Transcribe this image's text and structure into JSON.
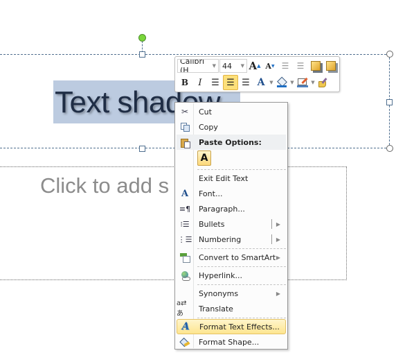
{
  "slide": {
    "title_text": "Text shadow",
    "subtitle_placeholder": "Click to add s"
  },
  "mini_toolbar": {
    "font_name": "Calibri (H",
    "font_size": "44",
    "buttons_row1": [
      "grow-font",
      "shrink-font",
      "decrease-indent",
      "increase-indent",
      "bring-to-front",
      "send-to-back"
    ],
    "buttons_row2": [
      "bold",
      "italic",
      "align-left",
      "align-center",
      "align-right",
      "font-color",
      "shape-fill",
      "shape-outline",
      "format-painter"
    ],
    "bold_glyph": "B",
    "italic_glyph": "I",
    "font_color_glyph": "A",
    "grow_glyph": "A",
    "shrink_glyph": "A",
    "active_button": "align-center",
    "colors": {
      "fill_accent": "#1f6fc4",
      "outline_accent": "#4f81bd",
      "active_bg": "#fde07a"
    }
  },
  "context_menu": {
    "items": [
      {
        "label": "Cut",
        "icon": "scissors-icon"
      },
      {
        "label": "Copy",
        "icon": "copy-icon"
      },
      {
        "label": "Paste Options:",
        "icon": "paste-icon",
        "section": true
      },
      {
        "label": "Exit Edit Text",
        "icon": ""
      },
      {
        "label": "Font...",
        "icon": "font-icon"
      },
      {
        "label": "Paragraph...",
        "icon": "paragraph-icon"
      },
      {
        "label": "Bullets",
        "icon": "bullets-icon",
        "submenu": true
      },
      {
        "label": "Numbering",
        "icon": "numbering-icon",
        "submenu": true
      },
      {
        "label": "Convert to SmartArt",
        "icon": "smartart-icon",
        "submenu": true
      },
      {
        "label": "Hyperlink...",
        "icon": "hyperlink-icon"
      },
      {
        "label": "Synonyms",
        "icon": "",
        "submenu": true
      },
      {
        "label": "Translate",
        "icon": "translate-icon"
      },
      {
        "label": "Format Text Effects...",
        "icon": "text-effects-icon",
        "highlighted": true
      },
      {
        "label": "Format Shape...",
        "icon": "format-shape-icon"
      }
    ],
    "paste_option_glyph": "A",
    "submenu_arrow": "▶"
  }
}
